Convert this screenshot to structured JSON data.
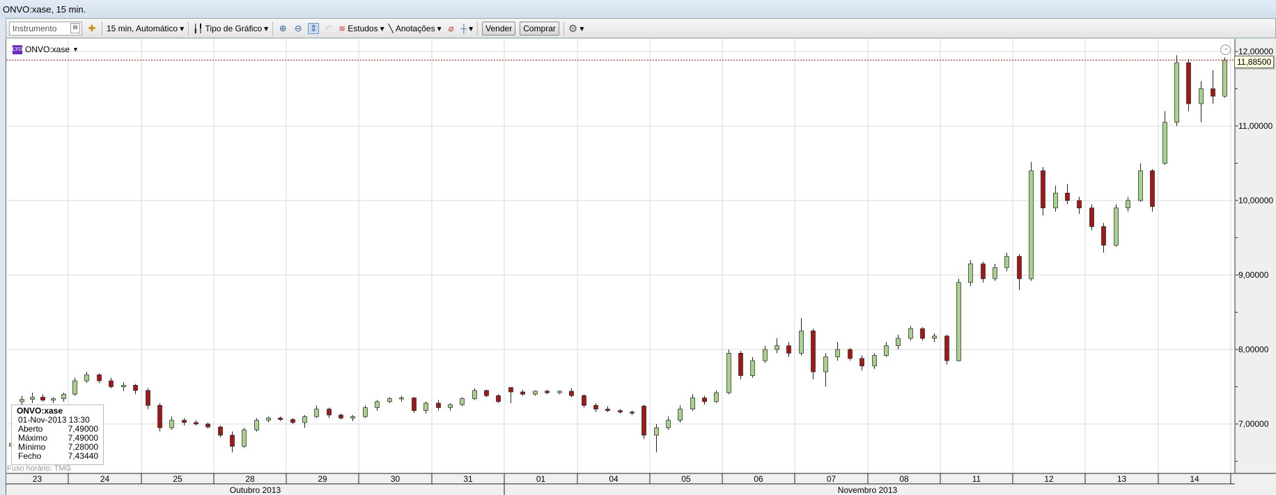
{
  "window": {
    "title": "ONVO:xase, 15 min."
  },
  "toolbar": {
    "instrument_placeholder": "Instrumento",
    "interval": "15 min,  Automático",
    "chart_type": "Tipo de Gráfico",
    "studies": "Estudos",
    "annotations": "Anotações",
    "sell": "Vender",
    "buy": "Comprar"
  },
  "symbol": {
    "name": "ONVO:xase",
    "badge": "CFD"
  },
  "info": {
    "symbol": "ONVO:xase",
    "datetime": "01-Nov-2013 13:30",
    "rows": [
      {
        "label": "Aberto",
        "value": "7,49000"
      },
      {
        "label": "Máximo",
        "value": "7,49000"
      },
      {
        "label": "Mínimo",
        "value": "7,28000"
      },
      {
        "label": "Fecho",
        "value": "7,43440"
      }
    ]
  },
  "timezone": "Fuso horário: TMG",
  "current_price": "11,88500",
  "colors": {
    "up": "#a9d18e",
    "down": "#a01818",
    "grid": "#d8d8d8",
    "last_line": "#c00000"
  },
  "chart_data": {
    "type": "candlestick",
    "ylim": [
      6.4,
      12.1
    ],
    "price_labels": [
      {
        "v": 12,
        "t": "12,00000"
      },
      {
        "v": 11,
        "t": "11,00000"
      },
      {
        "v": 10,
        "t": "10,00000"
      },
      {
        "v": 9,
        "t": "9,00000"
      },
      {
        "v": 8,
        "t": "8,00000"
      },
      {
        "v": 7,
        "t": "7,00000"
      }
    ],
    "days": [
      "23",
      "24",
      "25",
      "28",
      "29",
      "30",
      "31",
      "01",
      "04",
      "05",
      "06",
      "07",
      "08",
      "11",
      "12",
      "13",
      "14"
    ],
    "months": [
      {
        "label": "Outubro 2013",
        "from": 0,
        "to": 7
      },
      {
        "label": "Novembro 2013",
        "from": 7,
        "to": 17
      }
    ],
    "last_price": 11.885,
    "candles": [
      [
        [
          6.7,
          6.76,
          6.66,
          6.74
        ],
        [
          7.3,
          7.38,
          7.25,
          7.33
        ],
        [
          7.33,
          7.42,
          7.28,
          7.36
        ],
        [
          7.36,
          7.4,
          7.3,
          7.32
        ],
        [
          7.32,
          7.36,
          7.28,
          7.34
        ],
        [
          7.34,
          7.42,
          7.3,
          7.4
        ]
      ],
      [
        [
          7.4,
          7.62,
          7.38,
          7.58
        ],
        [
          7.58,
          7.7,
          7.55,
          7.66
        ],
        [
          7.66,
          7.68,
          7.55,
          7.58
        ],
        [
          7.58,
          7.62,
          7.48,
          7.5
        ],
        [
          7.5,
          7.56,
          7.44,
          7.52
        ],
        [
          7.52,
          7.54,
          7.4,
          7.45
        ]
      ],
      [
        [
          7.45,
          7.48,
          7.2,
          7.25
        ],
        [
          7.25,
          7.28,
          6.9,
          6.95
        ],
        [
          6.95,
          7.1,
          6.92,
          7.05
        ],
        [
          7.05,
          7.08,
          6.98,
          7.02
        ],
        [
          7.02,
          7.05,
          6.98,
          7.0
        ],
        [
          7.0,
          7.02,
          6.94,
          6.96
        ]
      ],
      [
        [
          6.96,
          6.98,
          6.82,
          6.85
        ],
        [
          6.85,
          6.9,
          6.62,
          6.7
        ],
        [
          6.7,
          6.95,
          6.68,
          6.92
        ],
        [
          6.92,
          7.08,
          6.9,
          7.05
        ],
        [
          7.05,
          7.1,
          7.02,
          7.08
        ],
        [
          7.08,
          7.1,
          7.04,
          7.06
        ]
      ],
      [
        [
          7.06,
          7.08,
          7.0,
          7.02
        ],
        [
          7.02,
          7.12,
          6.95,
          7.1
        ],
        [
          7.1,
          7.25,
          7.08,
          7.2
        ],
        [
          7.2,
          7.22,
          7.08,
          7.12
        ],
        [
          7.12,
          7.14,
          7.06,
          7.08
        ],
        [
          7.08,
          7.12,
          7.04,
          7.1
        ]
      ],
      [
        [
          7.1,
          7.25,
          7.08,
          7.22
        ],
        [
          7.22,
          7.32,
          7.18,
          7.3
        ],
        [
          7.3,
          7.36,
          7.28,
          7.34
        ],
        [
          7.34,
          7.38,
          7.3,
          7.35
        ],
        [
          7.35,
          7.36,
          7.15,
          7.18
        ],
        [
          7.18,
          7.3,
          7.14,
          7.28
        ]
      ],
      [
        [
          7.28,
          7.32,
          7.18,
          7.22
        ],
        [
          7.22,
          7.28,
          7.18,
          7.26
        ],
        [
          7.26,
          7.36,
          7.24,
          7.34
        ],
        [
          7.34,
          7.48,
          7.32,
          7.45
        ],
        [
          7.45,
          7.46,
          7.36,
          7.38
        ],
        [
          7.38,
          7.4,
          7.28,
          7.3
        ]
      ],
      [
        [
          7.49,
          7.49,
          7.28,
          7.43
        ],
        [
          7.43,
          7.46,
          7.38,
          7.4
        ],
        [
          7.4,
          7.45,
          7.38,
          7.44
        ],
        [
          7.44,
          7.46,
          7.4,
          7.42
        ],
        [
          7.42,
          7.45,
          7.4,
          7.44
        ],
        [
          7.44,
          7.48,
          7.36,
          7.38
        ]
      ],
      [
        [
          7.38,
          7.4,
          7.22,
          7.25
        ],
        [
          7.25,
          7.28,
          7.16,
          7.2
        ],
        [
          7.2,
          7.24,
          7.16,
          7.18
        ],
        [
          7.18,
          7.2,
          7.14,
          7.16
        ],
        [
          7.16,
          7.18,
          7.12,
          7.15
        ],
        [
          7.24,
          7.26,
          6.8,
          6.85
        ]
      ],
      [
        [
          6.85,
          7.0,
          6.62,
          6.95
        ],
        [
          6.95,
          7.1,
          6.92,
          7.05
        ],
        [
          7.05,
          7.25,
          7.02,
          7.2
        ],
        [
          7.2,
          7.4,
          7.18,
          7.35
        ],
        [
          7.35,
          7.38,
          7.26,
          7.3
        ],
        [
          7.3,
          7.45,
          7.28,
          7.42
        ]
      ],
      [
        [
          7.42,
          8.0,
          7.4,
          7.95
        ],
        [
          7.95,
          7.98,
          7.6,
          7.65
        ],
        [
          7.65,
          7.9,
          7.62,
          7.85
        ],
        [
          7.85,
          8.05,
          7.82,
          8.0
        ],
        [
          8.0,
          8.15,
          7.95,
          8.05
        ],
        [
          8.05,
          8.1,
          7.9,
          7.95
        ]
      ],
      [
        [
          7.95,
          8.42,
          7.92,
          8.25
        ],
        [
          8.25,
          8.28,
          7.6,
          7.7
        ],
        [
          7.7,
          7.95,
          7.5,
          7.9
        ],
        [
          7.9,
          8.1,
          7.85,
          8.0
        ],
        [
          8.0,
          8.02,
          7.85,
          7.88
        ],
        [
          7.88,
          7.92,
          7.72,
          7.78
        ]
      ],
      [
        [
          7.78,
          7.95,
          7.74,
          7.92
        ],
        [
          7.92,
          8.1,
          7.9,
          8.05
        ],
        [
          8.05,
          8.2,
          8.0,
          8.15
        ],
        [
          8.15,
          8.32,
          8.12,
          8.28
        ],
        [
          8.28,
          8.3,
          8.12,
          8.15
        ],
        [
          8.15,
          8.22,
          8.1,
          8.18
        ]
      ],
      [
        [
          8.18,
          8.2,
          7.8,
          7.85
        ],
        [
          7.85,
          8.95,
          7.84,
          8.9
        ],
        [
          8.9,
          9.2,
          8.85,
          9.15
        ],
        [
          9.15,
          9.18,
          8.9,
          8.95
        ],
        [
          8.95,
          9.15,
          8.92,
          9.1
        ],
        [
          9.1,
          9.3,
          9.05,
          9.25
        ]
      ],
      [
        [
          9.25,
          9.28,
          8.8,
          8.95
        ],
        [
          8.95,
          10.52,
          8.92,
          10.4
        ],
        [
          10.4,
          10.45,
          9.8,
          9.9
        ],
        [
          9.9,
          10.2,
          9.85,
          10.1
        ],
        [
          10.1,
          10.22,
          9.95,
          10.0
        ],
        [
          10.0,
          10.05,
          9.82,
          9.9
        ]
      ],
      [
        [
          9.9,
          9.95,
          9.6,
          9.65
        ],
        [
          9.65,
          9.7,
          9.3,
          9.4
        ],
        [
          9.4,
          9.95,
          9.38,
          9.9
        ],
        [
          9.9,
          10.05,
          9.85,
          10.0
        ],
        [
          10.0,
          10.5,
          9.98,
          10.4
        ],
        [
          10.4,
          10.42,
          9.85,
          9.92
        ]
      ],
      [
        [
          10.5,
          11.2,
          10.48,
          11.05
        ],
        [
          11.05,
          11.95,
          11.0,
          11.85
        ],
        [
          11.85,
          11.9,
          11.2,
          11.3
        ],
        [
          11.3,
          11.6,
          11.05,
          11.5
        ],
        [
          11.5,
          11.75,
          11.3,
          11.4
        ],
        [
          11.4,
          11.92,
          11.38,
          11.885
        ]
      ]
    ]
  }
}
